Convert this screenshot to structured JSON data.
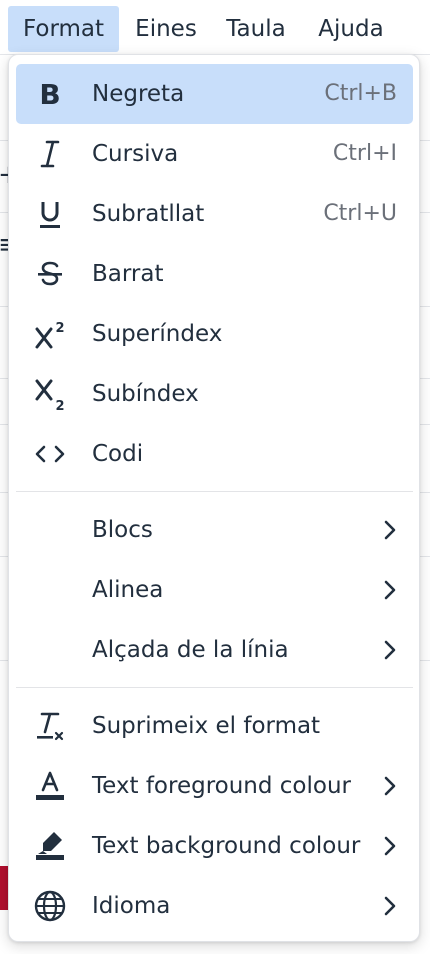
{
  "menubar": {
    "items": [
      {
        "label": "Format",
        "active": true
      },
      {
        "label": "Eines"
      },
      {
        "label": "Taula"
      },
      {
        "label": "Ajuda"
      }
    ]
  },
  "menu": {
    "items": [
      {
        "label": "Negreta",
        "shortcut": "Ctrl+B",
        "icon": "bold-icon",
        "active": true
      },
      {
        "label": "Cursiva",
        "shortcut": "Ctrl+I",
        "icon": "italic-icon"
      },
      {
        "label": "Subratllat",
        "shortcut": "Ctrl+U",
        "icon": "underline-icon"
      },
      {
        "label": "Barrat",
        "icon": "strikethrough-icon"
      },
      {
        "label": "Superíndex",
        "icon": "superscript-icon"
      },
      {
        "label": "Subíndex",
        "icon": "subscript-icon"
      },
      {
        "label": "Codi",
        "icon": "code-icon"
      },
      {
        "label": "Blocs",
        "submenu": true
      },
      {
        "label": "Alinea",
        "submenu": true
      },
      {
        "label": "Alçada de la línia",
        "submenu": true
      },
      {
        "label": "Suprimeix el format",
        "icon": "remove-formatting-icon"
      },
      {
        "label": "Text foreground colour",
        "icon": "text-color-icon",
        "submenu": true
      },
      {
        "label": "Text background colour",
        "icon": "highlight-color-icon",
        "submenu": true
      },
      {
        "label": "Idioma",
        "icon": "globe-icon",
        "submenu": true
      }
    ]
  },
  "colors": {
    "accent": "#c8defa",
    "text": "#222f3e",
    "muted": "#6b7079",
    "text_foreground_swatch": "#222f3e",
    "background_swatch": "#222f3e"
  }
}
